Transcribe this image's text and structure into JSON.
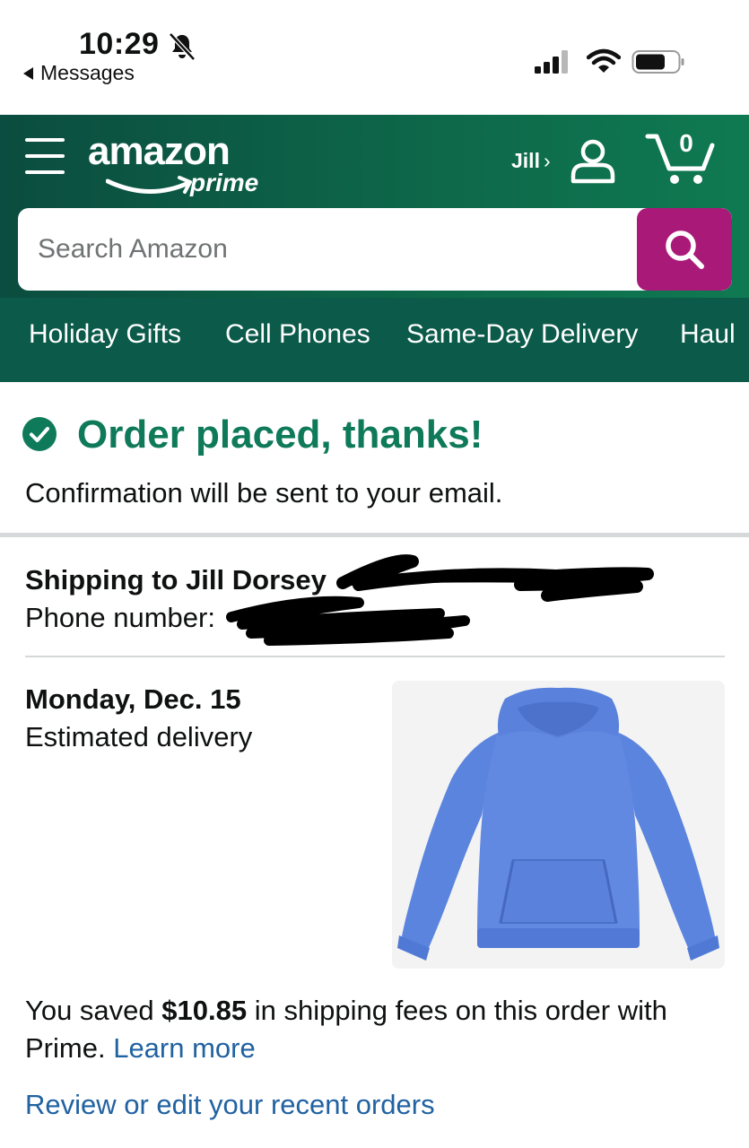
{
  "status_bar": {
    "time": "10:29",
    "back_app": "Messages",
    "icons": [
      "bell-slash-icon",
      "cellular-signal-icon",
      "wifi-icon",
      "battery-icon"
    ]
  },
  "header": {
    "logo_word": "amazon",
    "logo_sub": "prime",
    "account_label": "Jill",
    "account_chevron": "›",
    "cart_count": "0",
    "colors": {
      "header_green": "#0d6247",
      "search_button": "#a91a78"
    }
  },
  "search": {
    "placeholder": "Search Amazon",
    "value": ""
  },
  "nav": {
    "items": [
      "Holiday Gifts",
      "Cell Phones",
      "Same-Day Delivery",
      "Haul"
    ]
  },
  "confirmation": {
    "title": "Order placed, thanks!",
    "subtitle": "Confirmation will be sent to your email.",
    "title_color": "#0f7a5a"
  },
  "shipping": {
    "label": "Shipping to Jill Dorsey",
    "phone_label": "Phone number:"
  },
  "delivery": {
    "date": "Monday, Dec. 15",
    "label": "Estimated delivery",
    "product_image": "blue-hoodie"
  },
  "savings": {
    "prefix": "You saved",
    "amount": "$10.85",
    "suffix": "in shipping fees on this order with Prime.",
    "learn_more": "Learn more"
  },
  "review_link": "Review or edit your recent orders"
}
